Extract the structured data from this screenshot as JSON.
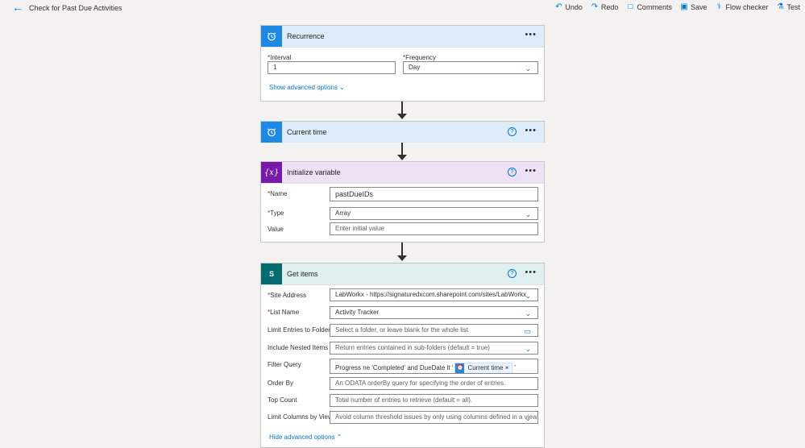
{
  "header": {
    "title": "Check for Past Due Activities",
    "undo": "Undo",
    "redo": "Redo",
    "comments": "Comments",
    "save": "Save",
    "flow_checker": "Flow checker",
    "test": "Test"
  },
  "recurrence": {
    "title": "Recurrence",
    "interval_label": "Interval",
    "interval_value": "1",
    "frequency_label": "Frequency",
    "frequency_value": "Day",
    "advanced_link": "Show advanced options"
  },
  "current_time": {
    "title": "Current time"
  },
  "init_variable": {
    "title": "Initialize variable",
    "name_label": "Name",
    "name_value": "pastDueIDs",
    "type_label": "Type",
    "type_value": "Array",
    "value_label": "Value",
    "value_placeholder": "Enter initial value"
  },
  "get_items": {
    "title": "Get items",
    "site_label": "Site Address",
    "site_value": "LabWorkx - https://signaturedxcom.sharepoint.com/sites/LabWorkx",
    "list_label": "List Name",
    "list_value": "Activity Tracker",
    "limit_folder_label": "Limit Entries to Folder",
    "limit_folder_placeholder": "Select a folder, or leave blank for the whole list",
    "nested_label": "Include Nested Items",
    "nested_placeholder": "Return entries contained in sub-folders (default = true)",
    "filter_label": "Filter Query",
    "filter_prefix": "Progress ne 'Completed' and DueDate lt '",
    "filter_token": "Current time",
    "filter_suffix": "'",
    "order_label": "Order By",
    "order_placeholder": "An ODATA orderBy query for specifying the order of entries.",
    "top_label": "Top Count",
    "top_placeholder": "Total number of entries to retrieve (default = all).",
    "limit_view_label": "Limit Columns by View",
    "limit_view_placeholder": "Avoid column threshold issues by only using columns defined in a view",
    "hide_link": "Hide advanced options"
  },
  "colors": {
    "recurrence_header": "#deecf9",
    "init_header": "#ede1f5",
    "getitems_header": "#dfeeee",
    "accent": "#0078d4"
  }
}
